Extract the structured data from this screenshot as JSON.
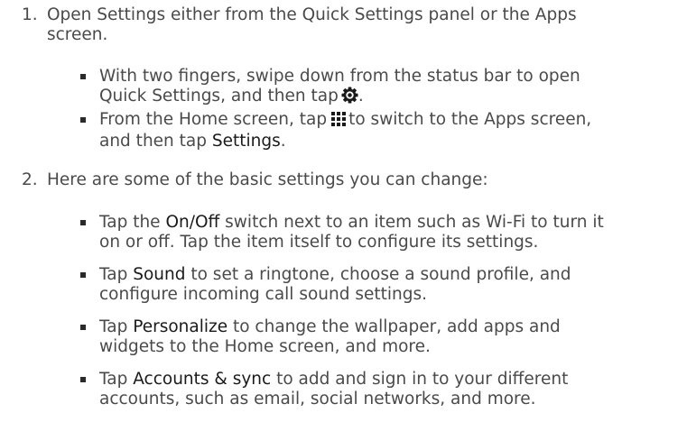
{
  "steps": [
    {
      "number": "1.",
      "line1": "Open Settings either from the Quick Settings panel or the Apps",
      "line2": "screen.",
      "bullets": [
        {
          "line1": "With two fingers, swipe down from the status bar to open",
          "line2_before": "Quick Settings, and then tap",
          "line2_icon": "settings-gear-icon",
          "line2_after": "."
        },
        {
          "line1_before": "From the Home screen, tap",
          "line1_icon": "apps-grid-icon",
          "line1_after": "to switch to the Apps screen,",
          "line2_before": "and then tap ",
          "line2_bold": "Settings",
          "line2_after": "."
        }
      ]
    },
    {
      "number": "2.",
      "line1": "Here are some of the basic settings you can change:",
      "bullets": [
        {
          "line1_before": "Tap the ",
          "line1_bold": "On/Off",
          "line1_after": " switch next to an item such as Wi-Fi to turn it",
          "line2": "on or off. Tap the item itself to configure its settings."
        },
        {
          "line1_before": "Tap ",
          "line1_bold": "Sound",
          "line1_after": " to set a ringtone, choose a sound profile, and",
          "line2": "configure incoming call sound settings."
        },
        {
          "line1_before": "Tap ",
          "line1_bold": "Personalize",
          "line1_after": " to change the wallpaper, add apps and",
          "line2": "widgets to the Home screen, and more."
        },
        {
          "line1_before": "Tap ",
          "line1_bold": "Accounts & sync",
          "line1_after": " to add and sign in to your different",
          "line2": "accounts, such as email, social networks, and more."
        }
      ]
    }
  ],
  "colors": {
    "text": "#4a4a4a",
    "emphasis": "#1a1a1a",
    "bullet": "#2a2a2a"
  }
}
